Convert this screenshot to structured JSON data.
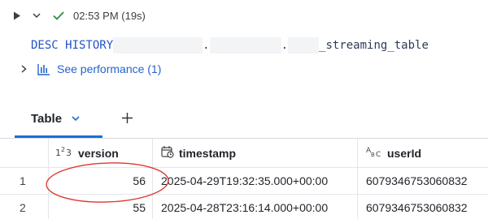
{
  "cell": {
    "run_status": "02:53 PM (19s)",
    "icons": {
      "run": "play-icon",
      "expand": "chevron-down-icon",
      "status": "check-icon"
    }
  },
  "code": {
    "keyword": "DESC HISTORY",
    "dot1": ".",
    "dot2": ".",
    "table_suffix": "_streaming_table"
  },
  "performance": {
    "label": "See performance (1)",
    "icons": {
      "expand": "chevron-right-icon",
      "chart": "bar-chart-icon"
    }
  },
  "tabs": [
    {
      "label": "Table",
      "active": true
    }
  ],
  "add_tab_icon": "plus-icon",
  "table": {
    "columns": [
      {
        "label": "version",
        "type_glyph": "1²3",
        "type": "integer"
      },
      {
        "label": "timestamp",
        "type_glyph": "calendar-clock-icon",
        "type": "timestamp"
      },
      {
        "label": "userId",
        "type_glyph": "ABC",
        "type": "string"
      }
    ],
    "rows": [
      {
        "index": "1",
        "version": "56",
        "timestamp": "2025-04-29T19:32:35.000+00:00",
        "userId": "6079346753060832"
      },
      {
        "index": "2",
        "version": "55",
        "timestamp": "2025-04-28T23:16:14.000+00:00",
        "userId": "6079346753060832"
      }
    ]
  },
  "colors": {
    "accent": "#1a6fd6",
    "success": "#2e8b3e",
    "annotation": "#e0372f",
    "keyword": "#2253c9"
  }
}
